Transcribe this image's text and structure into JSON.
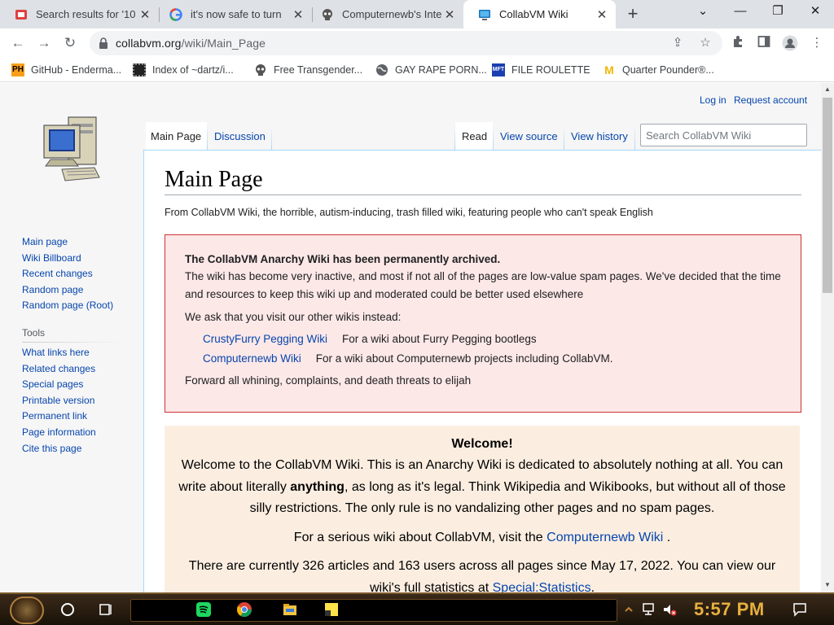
{
  "browser": {
    "tabs": [
      {
        "title": "Search results for '10",
        "active": false
      },
      {
        "title": "it's now safe to turn",
        "active": false
      },
      {
        "title": "Computernewb's Inte",
        "active": false
      },
      {
        "title": "CollabVM Wiki",
        "active": true
      }
    ],
    "url_host": "collabvm.org",
    "url_path": "/wiki/Main_Page",
    "bookmarks": [
      {
        "label": "GitHub - Enderma...",
        "icon": "ph-icon"
      },
      {
        "label": "Index of ~dartz/i...",
        "icon": "chip-icon"
      },
      {
        "label": "Free Transgender...",
        "icon": "skull-icon"
      },
      {
        "label": "GAY RAPE PORN...",
        "icon": "globe-icon"
      },
      {
        "label": "FILE ROULETTE",
        "icon": "mft-icon"
      },
      {
        "label": "Quarter Pounder®...",
        "icon": "mcdonalds-icon"
      }
    ]
  },
  "wiki": {
    "login": "Log in",
    "request_account": "Request account",
    "nav_main": [
      "Main page",
      "Wiki Billboard",
      "Recent changes",
      "Random page",
      "Random page (Root)"
    ],
    "tools_heading": "Tools",
    "tools": [
      "What links here",
      "Related changes",
      "Special pages",
      "Printable version",
      "Permanent link",
      "Page information",
      "Cite this page"
    ],
    "tabs_left": [
      "Main Page",
      "Discussion"
    ],
    "tabs_right": [
      "Read",
      "View source",
      "View history"
    ],
    "search_placeholder": "Search CollabVM Wiki",
    "title": "Main Page",
    "subtitle": "From CollabVM Wiki, the horrible, autism-inducing, trash filled wiki, featuring people who can't speak English",
    "archive": {
      "heading": "The CollabVM Anarchy Wiki has been permanently archived.",
      "text": "The wiki has become very inactive, and most if not all of the pages are low-value spam pages. We've decided that the time and resources to keep this wiki up and moderated could be better used elsewhere",
      "ask": "We ask that you visit our other wikis instead:",
      "links": [
        {
          "name": "CrustyFurry Pegging Wiki",
          "desc": "For a wiki about Furry Pegging bootlegs"
        },
        {
          "name": "Computernewb Wiki",
          "desc": "For a wiki about Computernewb projects including CollabVM."
        }
      ],
      "footer": "Forward all whining, complaints, and death threats to elijah"
    },
    "welcome": {
      "title": "Welcome!",
      "p1_a": "Welcome to the CollabVM Wiki. This is an Anarchy Wiki is dedicated to absolutely nothing at all. You can write about literally ",
      "p1_bold": "anything",
      "p1_b": ", as long as it's legal. Think Wikipedia and Wikibooks, but without all of those silly restrictions. The only rule is no vandalizing other pages and no spam pages.",
      "p2_a": "For a serious wiki about CollabVM, visit the ",
      "p2_link": "Computernewb Wiki",
      "p2_b": " .",
      "p3_a": "There are currently 326 articles and 163 users across all pages since May 17, 2022. You can view our wiki's full statistics at ",
      "p3_link": "Special:Statistics",
      "p3_b": "."
    }
  },
  "taskbar": {
    "clock": "5:57 PM"
  },
  "colors": {
    "link": "#0645ad",
    "archive_bg": "#fde8e8",
    "archive_border": "#cc3333",
    "welcome_bg": "#fbeee1",
    "clock": "#e8b040"
  }
}
